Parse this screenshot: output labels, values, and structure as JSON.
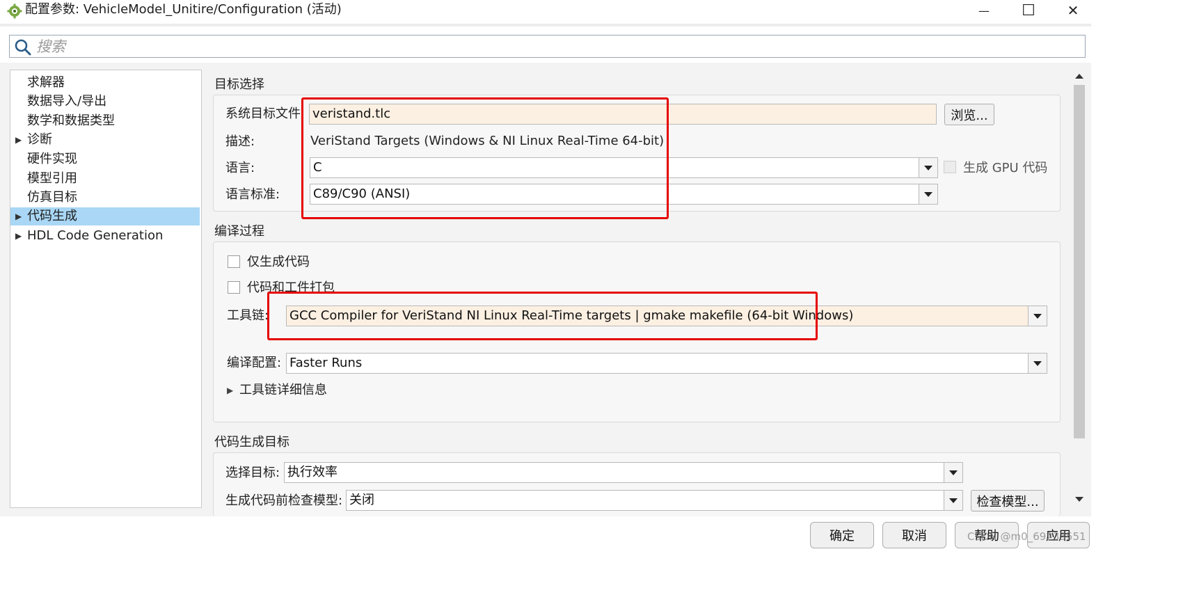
{
  "window": {
    "title": "配置参数: VehicleModel_Unitire/Configuration (活动)",
    "minimize_glyph": "—",
    "maximize_glyph": "☐",
    "close_glyph": "✕"
  },
  "search": {
    "placeholder": "搜索"
  },
  "tree": {
    "items": [
      {
        "label": "求解器",
        "expandable": false,
        "selected": false
      },
      {
        "label": "数据导入/导出",
        "expandable": false,
        "selected": false
      },
      {
        "label": "数学和数据类型",
        "expandable": false,
        "selected": false
      },
      {
        "label": "诊断",
        "expandable": true,
        "selected": false
      },
      {
        "label": "硬件实现",
        "expandable": false,
        "selected": false
      },
      {
        "label": "模型引用",
        "expandable": false,
        "selected": false
      },
      {
        "label": "仿真目标",
        "expandable": false,
        "selected": false
      },
      {
        "label": "代码生成",
        "expandable": true,
        "selected": true
      },
      {
        "label": "HDL Code Generation",
        "expandable": true,
        "selected": false
      }
    ],
    "arrow_glyph": "▶"
  },
  "target_selection": {
    "title": "目标选择",
    "system_target_label": "系统目标文件:",
    "system_target_value": "veristand.tlc",
    "browse_label": "浏览...",
    "description_label": "描述:",
    "description_value": "VeriStand Targets (Windows & NI Linux Real-Time 64-bit)",
    "language_label": "语言:",
    "language_value": "C",
    "gpu_label": "生成 GPU 代码",
    "language_standard_label": "语言标准:",
    "language_standard_value": "C89/C90 (ANSI)"
  },
  "build_process": {
    "title": "编译过程",
    "generate_only_label": "仅生成代码",
    "package_label": "代码和工件打包",
    "toolchain_label": "工具链:",
    "toolchain_value": "GCC Compiler for VeriStand NI Linux Real-Time targets | gmake makefile (64-bit Windows)",
    "build_config_label": "编译配置:",
    "build_config_value": "Faster Runs",
    "toolchain_details_label": "工具链详细信息",
    "expander_glyph": "▶"
  },
  "codegen_objectives": {
    "title": "代码生成目标",
    "select_objective_label": "选择目标:",
    "select_objective_value": "执行效率",
    "check_model_label": "生成代码前检查模型:",
    "check_model_value": "关闭",
    "check_model_button": "检查模型..."
  },
  "footer": {
    "ok": "确定",
    "cancel": "取消",
    "help": "帮助",
    "apply": "应用",
    "watermark": "CSDN @m0_69233551"
  },
  "colors": {
    "selection": "#a9d7f5",
    "highlight_field": "#fcf0e2",
    "annotation_red": "#e60000"
  }
}
